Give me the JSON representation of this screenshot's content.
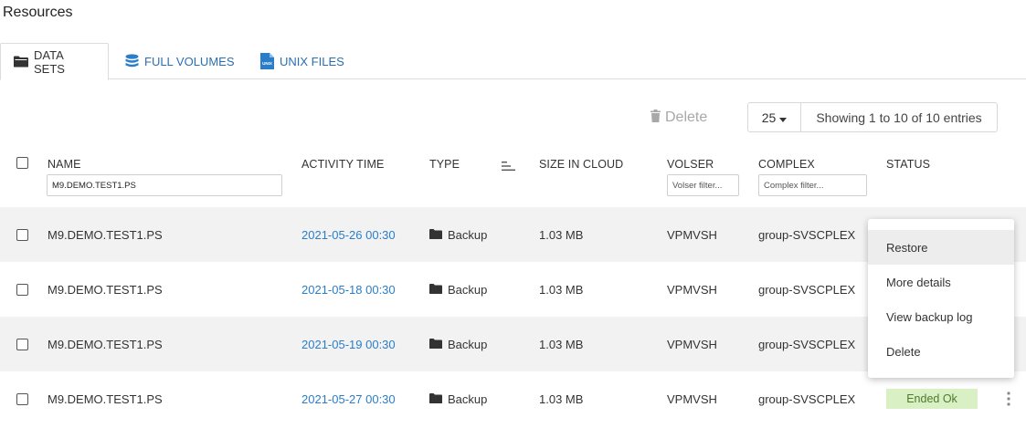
{
  "page": {
    "title": "Resources"
  },
  "tabs": [
    {
      "label": "DATA SETS",
      "icon": "folder-icon",
      "active": true
    },
    {
      "label": "FULL VOLUMES",
      "icon": "database-icon",
      "active": false
    },
    {
      "label": "UNIX FILES",
      "icon": "unix-file-icon",
      "active": false
    }
  ],
  "toolbar": {
    "delete_label": "Delete",
    "page_size": "25",
    "entries_text": "Showing 1 to 10 of 10 entries"
  },
  "table": {
    "headers": {
      "name": "NAME",
      "activity_time": "ACTIVITY TIME",
      "type": "TYPE",
      "size_in_cloud": "SIZE IN CLOUD",
      "volser": "VOLSER",
      "complex": "COMPLEX",
      "status": "STATUS"
    },
    "filters": {
      "name_value": "M9.DEMO.TEST1.PS",
      "volser_placeholder": "Volser filter...",
      "complex_placeholder": "Complex filter..."
    },
    "rows": [
      {
        "name": "M9.DEMO.TEST1.PS",
        "activity_time": "2021-05-26 00:30",
        "type": "Backup",
        "size": "1.03 MB",
        "volser": "VPMVSH",
        "complex": "group-SVSCPLEX",
        "status": ""
      },
      {
        "name": "M9.DEMO.TEST1.PS",
        "activity_time": "2021-05-18 00:30",
        "type": "Backup",
        "size": "1.03 MB",
        "volser": "VPMVSH",
        "complex": "group-SVSCPLEX",
        "status": ""
      },
      {
        "name": "M9.DEMO.TEST1.PS",
        "activity_time": "2021-05-19 00:30",
        "type": "Backup",
        "size": "1.03 MB",
        "volser": "VPMVSH",
        "complex": "group-SVSCPLEX",
        "status": ""
      },
      {
        "name": "M9.DEMO.TEST1.PS",
        "activity_time": "2021-05-27 00:30",
        "type": "Backup",
        "size": "1.03 MB",
        "volser": "VPMVSH",
        "complex": "group-SVSCPLEX",
        "status": "Ended Ok"
      }
    ]
  },
  "context_menu": {
    "items": [
      "Restore",
      "More details",
      "View backup log",
      "Delete"
    ],
    "hovered": "Restore"
  },
  "colors": {
    "link": "#2a7dc9",
    "status_ok_bg": "#d8f0c4",
    "status_ok_text": "#4e7a2b",
    "row_shade": "#f2f2f2"
  }
}
